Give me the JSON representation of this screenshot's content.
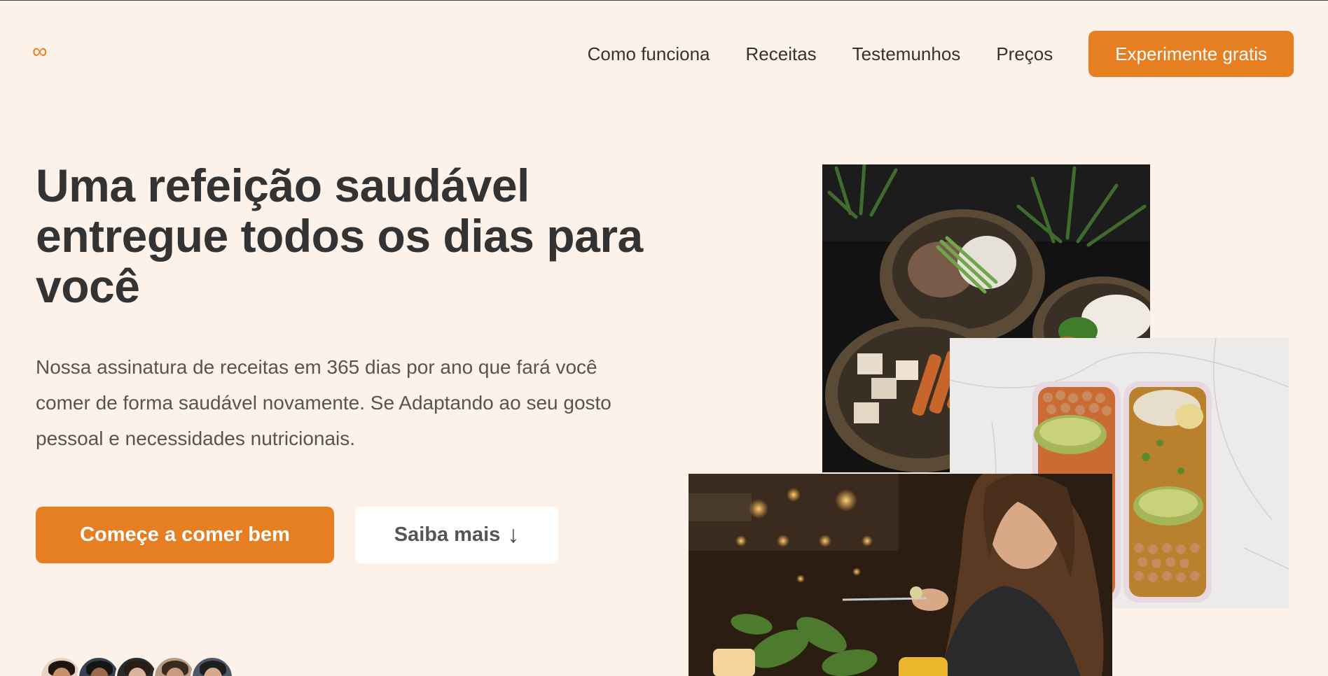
{
  "header": {
    "logo_icon": "infinity-icon",
    "logo_glyph": "∞",
    "nav": [
      {
        "label": "Como funciona"
      },
      {
        "label": "Receitas"
      },
      {
        "label": "Testemunhos"
      },
      {
        "label": "Preços"
      }
    ],
    "cta_label": "Experimente gratis"
  },
  "hero": {
    "title": "Uma refeição saudável entregue todos os dias para você",
    "description": "Nossa assinatura de receitas em 365 dias por ano que fará você comer de forma saudável novamente. Se Adaptando ao seu gosto pessoal e necessidades nutricionais.",
    "primary_button": "Começe a comer bem",
    "secondary_button": "Saiba mais",
    "secondary_arrow": "↓"
  },
  "colors": {
    "accent": "#e67e22",
    "background": "#fdf2e9",
    "text": "#333333"
  },
  "avatars": [
    {
      "skin": "#c8906a",
      "hair": "#1b1410",
      "bg": "#e7d2c2"
    },
    {
      "skin": "#9a6a4a",
      "hair": "#151515",
      "bg": "#3a4150"
    },
    {
      "skin": "#d9b39a",
      "hair": "#2a1d16",
      "bg": "#2b2b2b"
    },
    {
      "skin": "#c89a80",
      "hair": "#3b2a20",
      "bg": "#b99a84"
    },
    {
      "skin": "#d6a98c",
      "hair": "#1e1e1e",
      "bg": "#4f5866"
    }
  ]
}
